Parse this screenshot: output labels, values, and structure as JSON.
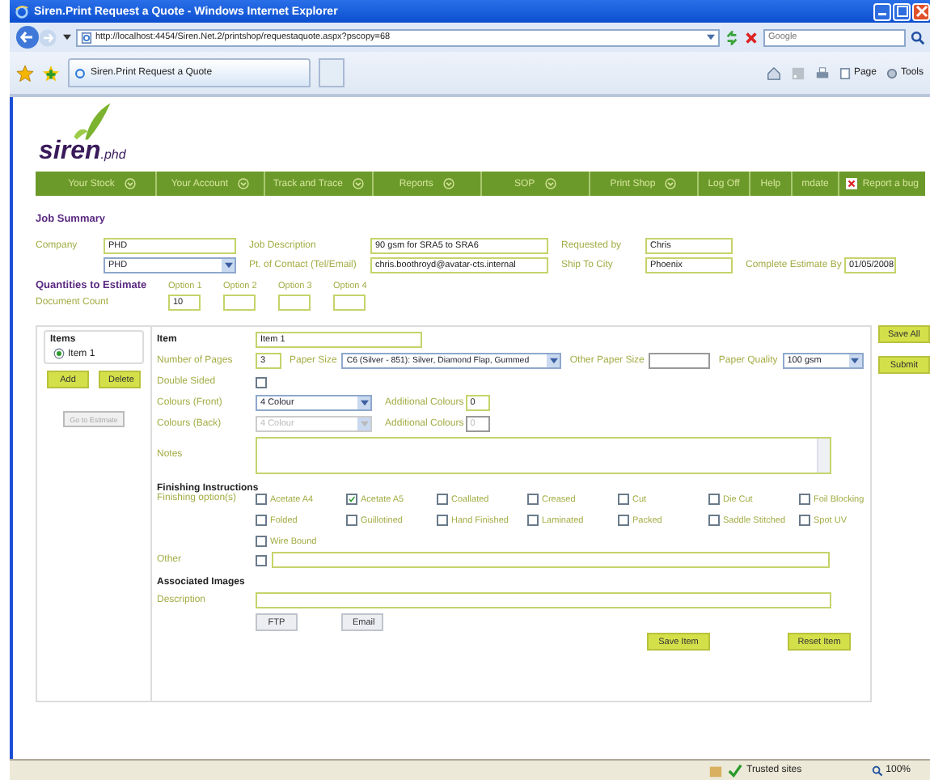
{
  "window": {
    "title": "Siren.Print Request a Quote - Windows Internet Explorer"
  },
  "address_bar": {
    "url": "http://localhost:4454/Siren.Net.2/printshop/requestaquote.aspx?pscopy=68"
  },
  "search": {
    "placeholder": "Google"
  },
  "tabs": [
    {
      "label": "Siren.Print Request a Quote",
      "selected": true
    }
  ],
  "command_bar": {
    "page": "Page",
    "tools": "Tools"
  },
  "logo": {
    "name": "siren",
    "suffix": ".phd"
  },
  "nav": [
    {
      "label": "Your Stock",
      "kind": "menu"
    },
    {
      "label": "Your Account",
      "kind": "menu"
    },
    {
      "label": "Track and Trace",
      "kind": "menu"
    },
    {
      "label": "Reports",
      "kind": "menu"
    },
    {
      "label": "SOP",
      "kind": "menu"
    },
    {
      "label": "Print Shop",
      "kind": "menu"
    },
    {
      "label": "Log Off",
      "kind": "link"
    },
    {
      "label": "Help",
      "kind": "link"
    },
    {
      "label": "mdate",
      "kind": "link"
    },
    {
      "label": "Report a bug",
      "kind": "bug"
    }
  ],
  "job_summary": {
    "title": "Job Summary",
    "company_label": "Company",
    "company": "PHD",
    "company_select": "PHD",
    "job_description_label": "Job Description",
    "job_description": "90 gsm for SRA5 to SRA6",
    "contact_label": "Pt. of Contact (Tel/Email)",
    "contact": "chris.boothroyd@avatar-cts.internal",
    "requested_by_label": "Requested by",
    "requested_by": "Chris",
    "ship_to_label": "Ship To City",
    "ship_to": "Phoenix",
    "complete_by_label": "Complete Estimate By",
    "complete_by": "01/05/2008"
  },
  "quantities": {
    "title": "Quantities to Estimate",
    "row_label": "Document Count",
    "options": [
      {
        "label": "Option 1",
        "value": "10"
      },
      {
        "label": "Option 2"
      },
      {
        "label": "Option 3"
      },
      {
        "label": "Option 4"
      }
    ]
  },
  "items_panel": {
    "title": "Items",
    "items": [
      {
        "label": "Item 1",
        "selected": true
      }
    ],
    "add": "Add",
    "delete": "Delete",
    "estimate": {
      "label": "Go to Estimate",
      "disabled": true
    }
  },
  "item": {
    "title": "Item",
    "name": "Item 1",
    "pages_label": "Number of Pages",
    "pages": "3",
    "paper_size_label": "Paper Size",
    "paper_size": "C6 (Silver - 851): Silver, Diamond Flap, Gummed",
    "other_size_label": "Other Paper Size",
    "paper_quality_label": "Paper Quality",
    "paper_quality": "100 gsm",
    "double_sided_label": "Double Sided",
    "double_sided": false,
    "colours": [
      {
        "label": "Colours (Front)",
        "value": "4 Colour",
        "disabled": false,
        "additional_label": "Additional Colours",
        "additional": "0"
      },
      {
        "label": "Colours (Back)",
        "value": "4 Colour",
        "disabled": true,
        "additional_label": "Additional Colours",
        "additional": "0"
      }
    ],
    "notes_label": "Notes"
  },
  "finishing": {
    "title": "Finishing Instructions",
    "options_label": "Finishing option(s)",
    "options": [
      {
        "label": "Acetate A4",
        "checked": false
      },
      {
        "label": "Acetate A5",
        "checked": true
      },
      {
        "label": "Coallated",
        "checked": false
      },
      {
        "label": "Creased",
        "checked": false
      },
      {
        "label": "Cut",
        "checked": false
      },
      {
        "label": "Die Cut",
        "checked": false
      },
      {
        "label": "Foil Blocking",
        "checked": false
      },
      {
        "label": "Folded",
        "checked": false
      },
      {
        "label": "Guillotined",
        "checked": false
      },
      {
        "label": "Hand Finished",
        "checked": false
      },
      {
        "label": "Laminated",
        "checked": false
      },
      {
        "label": "Packed",
        "checked": false
      },
      {
        "label": "Saddle Stitched",
        "checked": false
      },
      {
        "label": "Spot UV",
        "checked": false
      },
      {
        "label": "Wire Bound",
        "checked": false
      }
    ],
    "other_label": "Other",
    "other_checked": false
  },
  "images": {
    "title": "Associated Images",
    "description_label": "Description",
    "ftp": "FTP",
    "email": "Email"
  },
  "item_buttons": {
    "save": "Save Item",
    "reset": "Reset Item"
  },
  "side_buttons": {
    "save_all": "Save All",
    "submit": "Submit"
  },
  "status_bar": {
    "zone": "Trusted sites",
    "zoom": "100%"
  }
}
